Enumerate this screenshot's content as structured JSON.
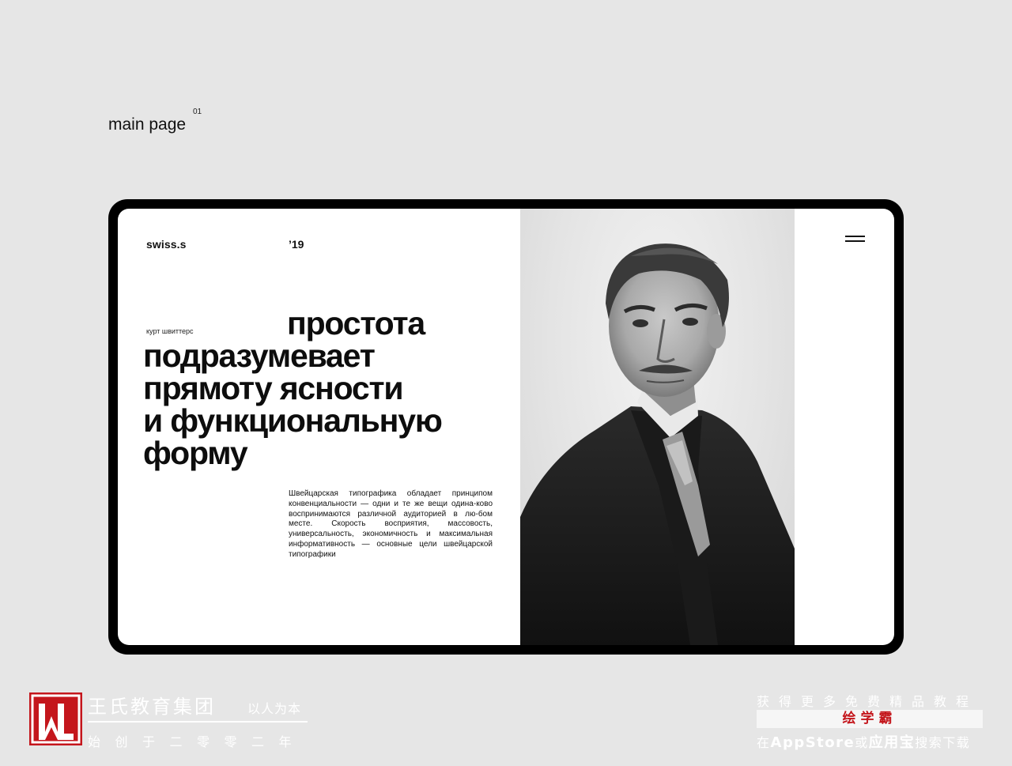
{
  "page": {
    "label": "main page",
    "number": "01"
  },
  "site": {
    "brand": "swiss.s",
    "year": "’19",
    "author": "курт швиттерс",
    "headline": [
      "простота",
      "подразумевает",
      "прямоту ясности",
      "и функциональную",
      "форму"
    ],
    "body": "Швейцарская типографика обладает принципом конвенциальности — одни и те же вещи одина-ково воспринимаются различной аудиторией в лю-бом месте. Скорость восприятия, массовость, универсальность, экономичность и максимальная информативность — основные цели швейцарской типографики",
    "menu_icon": "hamburger-icon",
    "photo_subject": "portrait"
  },
  "footer_left": {
    "org_name": "王氏教育集团",
    "motto": "以人为本",
    "since": "始创于二零零二年",
    "logo_color": "#c4161c"
  },
  "footer_right": {
    "top": "获得更多免费精品教程",
    "brand": "绘学霸",
    "bottom_pre": "在",
    "bottom_store": "AppStore",
    "bottom_mid": "或",
    "bottom_market": "应用宝",
    "bottom_post": "搜索下载"
  },
  "colors": {
    "background": "#e6e6e6",
    "frame": "#000000",
    "accent_red": "#c4161c"
  }
}
